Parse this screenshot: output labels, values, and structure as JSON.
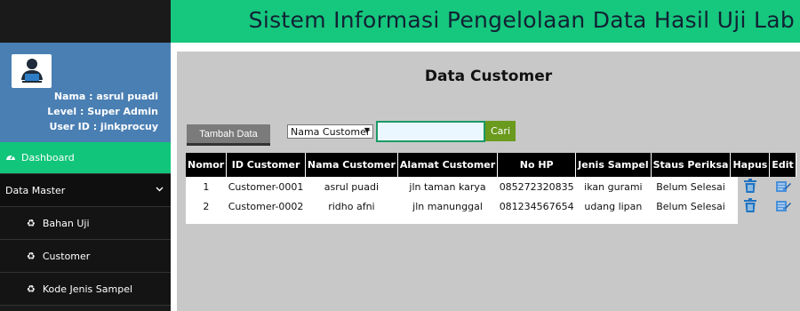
{
  "header": {
    "title": "Sistem Informasi Pengelolaan Data Hasil Uji Lab"
  },
  "profile": {
    "name": "Nama : asrul puadi",
    "level": "Level : Super Admin",
    "user_id": "User ID : jinkprocuy",
    "avatar_icon": "user-laptop-icon"
  },
  "sidebar": {
    "dashboard": "Dashboard",
    "data_master": "Data Master",
    "items": [
      {
        "label": "Bahan Uji",
        "icon": "recycle-icon"
      },
      {
        "label": "Customer",
        "icon": "recycle-icon"
      },
      {
        "label": "Kode Jenis Sampel",
        "icon": "recycle-icon"
      }
    ]
  },
  "main": {
    "page_title": "Data Customer",
    "add_button": "Tambah Data",
    "filter_select": "Nama Customer",
    "search_value": "",
    "search_button": "Cari",
    "columns": [
      "Nomor",
      "ID Customer",
      "Nama Customer",
      "Alamat Customer",
      "No HP",
      "Jenis Sampel",
      "Staus Periksa",
      "Hapus",
      "Edit"
    ],
    "rows": [
      {
        "no": "1",
        "id": "Customer-0001",
        "nama": "asrul puadi",
        "alamat": "jln taman karya",
        "hp": "085272320835",
        "jenis": "ikan gurami",
        "status": "Belum Selesai"
      },
      {
        "no": "2",
        "id": "Customer-0002",
        "nama": "ridho afni",
        "alamat": "jln manunggal",
        "hp": "081234567654",
        "jenis": "udang lipan",
        "status": "Belum Selesai"
      }
    ]
  },
  "colors": {
    "header_green": "#16c77e",
    "profile_blue": "#4a7fb3",
    "sidebar_dark": "#1a1a1a",
    "cari_green": "#6a9a1e"
  }
}
